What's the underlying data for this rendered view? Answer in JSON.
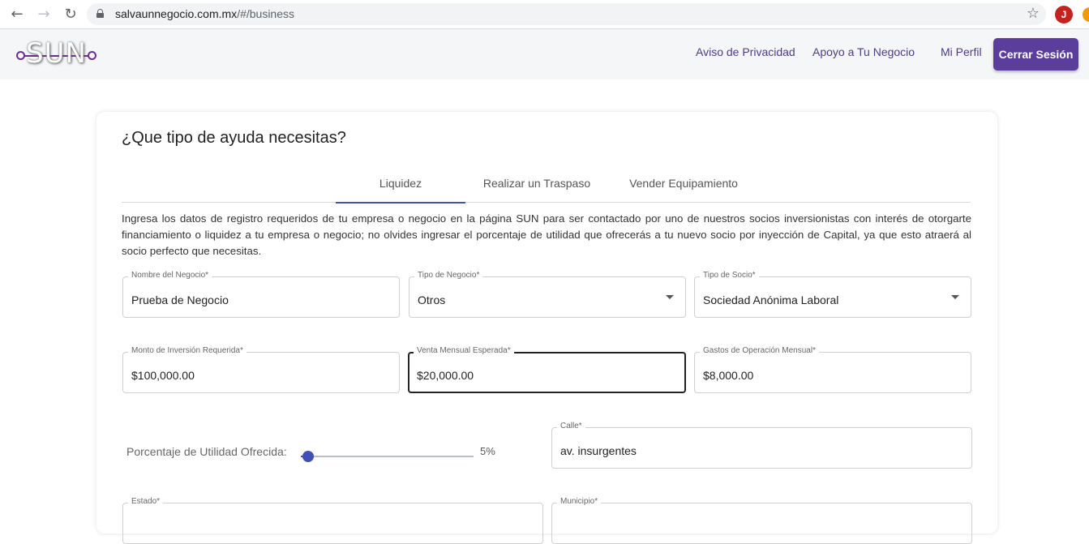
{
  "browser": {
    "url_host": "salvaunnegocio.com.mx",
    "url_path": "/#/business",
    "profile_initial": "J"
  },
  "header": {
    "logo_text": "SUN",
    "nav": {
      "privacy": "Aviso de Privacidad",
      "support": "Apoyo a Tu Negocio",
      "profile": "Mi Perfil",
      "logout": "Cerrar Sesión"
    }
  },
  "colors": {
    "brand_purple": "#5b3e9c",
    "tab_indicator": "#3f51b5",
    "slider": "#3f51b5"
  },
  "form": {
    "title": "¿Que tipo de ayuda necesitas?",
    "tabs": [
      {
        "label": "Liquidez",
        "active": true
      },
      {
        "label": "Realizar un Traspaso",
        "active": false
      },
      {
        "label": "Vender Equipamiento",
        "active": false
      }
    ],
    "description": "Ingresa los datos de registro requeridos de tu empresa o negocio en la página SUN para ser contactado por uno de nuestros socios inversionistas con interés de otorgarte financiamiento o liquidez a tu empresa o negocio; no olvides ingresar el porcentaje de utilidad que ofrecerás a tu nuevo socio por inyección de Capital, ya que esto atraerá al socio perfecto que necesitas.",
    "fields": {
      "business_name": {
        "label": "Nombre del Negocio*",
        "value": "Prueba de Negocio"
      },
      "business_type": {
        "label": "Tipo de Negocio*",
        "value": "Otros"
      },
      "partner_type": {
        "label": "Tipo de Socio*",
        "value": "Sociedad Anónima Laboral"
      },
      "investment": {
        "label": "Monto de Inversión Requerida*",
        "value": "$100,000.00"
      },
      "monthly_sales": {
        "label": "Venta Mensual Esperada*",
        "value": "$20,000.00"
      },
      "monthly_expenses": {
        "label": "Gastos de Operación Mensual*",
        "value": "$8,000.00"
      },
      "street": {
        "label": "Calle*",
        "value": "av. insurgentes"
      },
      "state": {
        "label": "Estado*",
        "value": ""
      },
      "municipality": {
        "label": "Municipio*",
        "value": ""
      }
    },
    "profit_slider": {
      "label": "Porcentaje de Utilidad Ofrecida:",
      "value_text": "5%",
      "value": 5
    }
  }
}
